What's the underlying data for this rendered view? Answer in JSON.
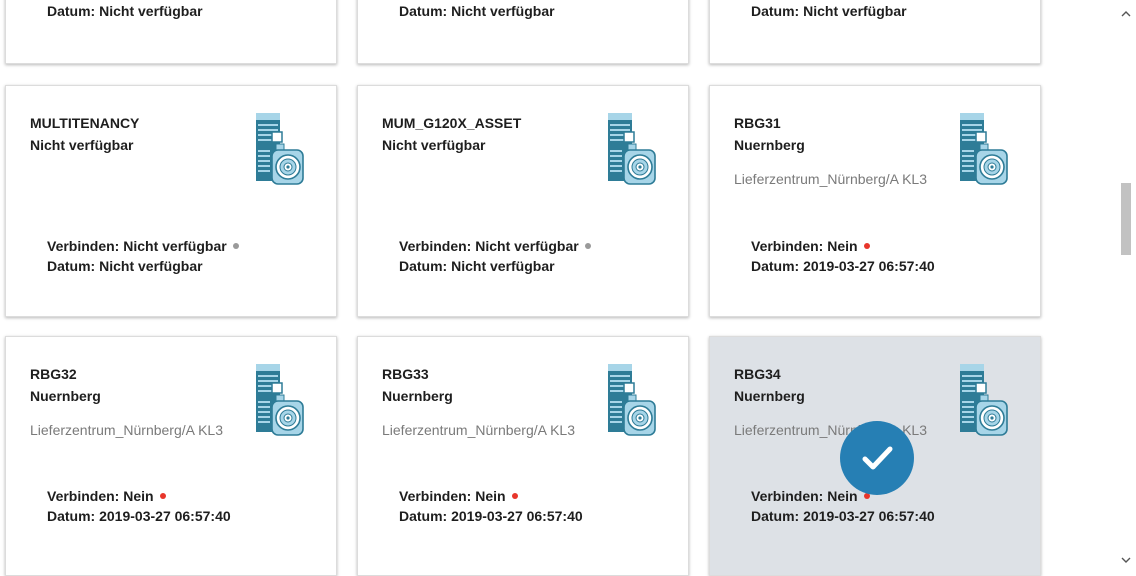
{
  "colors": {
    "status_grey": "#9a9a9a",
    "status_red": "#e8362b",
    "selected_bg": "#dde1e6",
    "check_blue": "#267fb4",
    "icon_teal": "#2e7c97",
    "icon_light": "#a7d5e8"
  },
  "top_cards": [
    {
      "date": "Datum: Nicht verfügbar"
    },
    {
      "date": "Datum: Nicht verfügbar"
    },
    {
      "date": "Datum: Nicht verfügbar"
    }
  ],
  "cards": [
    {
      "name": "MULTITENANCY",
      "location": "Nicht verfügbar",
      "path": "",
      "connect": "Verbinden: Nicht verfügbar",
      "status_color": "#9a9a9a",
      "date": "Datum: Nicht verfügbar",
      "icon": "drive-motor-icon"
    },
    {
      "name": "MUM_G120X_ASSET",
      "location": "Nicht verfügbar",
      "path": "",
      "connect": "Verbinden: Nicht verfügbar",
      "status_color": "#9a9a9a",
      "date": "Datum: Nicht verfügbar",
      "icon": "drive-motor-icon"
    },
    {
      "name": "RBG31",
      "location": "Nuernberg",
      "path": "Lieferzentrum_Nürnberg/A KL3",
      "connect": "Verbinden: Nein",
      "status_color": "#e8362b",
      "date": "Datum: 2019-03-27 06:57:40",
      "icon": "drive-motor-icon"
    },
    {
      "name": "RBG32",
      "location": "Nuernberg",
      "path": "Lieferzentrum_Nürnberg/A KL3",
      "connect": "Verbinden: Nein",
      "status_color": "#e8362b",
      "date": "Datum: 2019-03-27 06:57:40",
      "icon": "drive-motor-icon"
    },
    {
      "name": "RBG33",
      "location": "Nuernberg",
      "path": "Lieferzentrum_Nürnberg/A KL3",
      "connect": "Verbinden: Nein",
      "status_color": "#e8362b",
      "date": "Datum: 2019-03-27 06:57:40",
      "icon": "drive-motor-icon"
    },
    {
      "name": "RBG34",
      "location": "Nuernberg",
      "path": "Lieferzentrum_Nürnberg/A KL3",
      "connect": "Verbinden: Nein",
      "status_color": "#e8362b",
      "date": "Datum: 2019-03-27 06:57:40",
      "icon": "drive-motor-icon",
      "selected": true
    }
  ],
  "selection_icon": "checkmark-icon",
  "scrollbar": {
    "up_icon": "chevron-up-icon",
    "down_icon": "chevron-down-icon"
  }
}
